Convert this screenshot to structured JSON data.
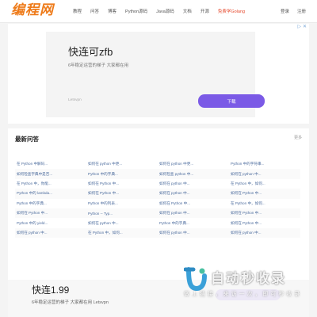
{
  "header": {
    "logo": "编程网",
    "nav": [
      {
        "label": "教程",
        "accent": false
      },
      {
        "label": "问答",
        "accent": false
      },
      {
        "label": "博客",
        "accent": false
      },
      {
        "label": "Python源码",
        "accent": false
      },
      {
        "label": "Java源码",
        "accent": false
      },
      {
        "label": "文档",
        "accent": false
      },
      {
        "label": "开源",
        "accent": false
      },
      {
        "label": "免费学Golang",
        "accent": true
      }
    ],
    "login": "登录",
    "register": "注册"
  },
  "ad": {
    "icons": [
      "▷",
      "✕"
    ],
    "title": "快连可zfb",
    "subtitle": "6年稳定运营的梯子 大家都在用",
    "brand": "Letsvpn",
    "button": "下载"
  },
  "qa": {
    "title": "最新问答",
    "more": "更多",
    "items": [
      "在 Python 中解码...",
      "如何在 python 中更...",
      "如何在 python 中更...",
      "Python 中的字符串...",
      "如何检查字典中是否...",
      "Python 中的字典...",
      "如何检查 python 中...",
      "如何在 python 中...",
      "在 Python 中，你能...",
      "如何在 Python 中...",
      "如何在 python 中...",
      "在 Python 中，如何...",
      "Python 中的 lambda...",
      "如何在 Python 中...",
      "如何在 python 中...",
      "如何在 Python 中...",
      "Python 中的字典...",
      "Python 中的列表...",
      "如何在 Python 中...",
      "在 Python 中，如何...",
      "如何在 Python 中...",
      "Python -- Typ...",
      "如何在 python 中...",
      "如何在 Python 中...",
      "Python 中的 yield...",
      "如何在 python 中...",
      "Python 中的字典...",
      "如何在 Python 中...",
      "如何在 python 中...",
      "在 Python 中，如何...",
      "如何在 python 中...",
      "如何在 python 中..."
    ]
  },
  "bottom_ad": {
    "title": "快连1.99",
    "subtitle": "6年稳定运营的梯子 大家都在用 Letsvpn"
  },
  "watermark": {
    "title": "自动秒收录",
    "subtitle": "做 上 链 接 ， 来 访 一 次 ， 即 可 秒 收 录"
  }
}
